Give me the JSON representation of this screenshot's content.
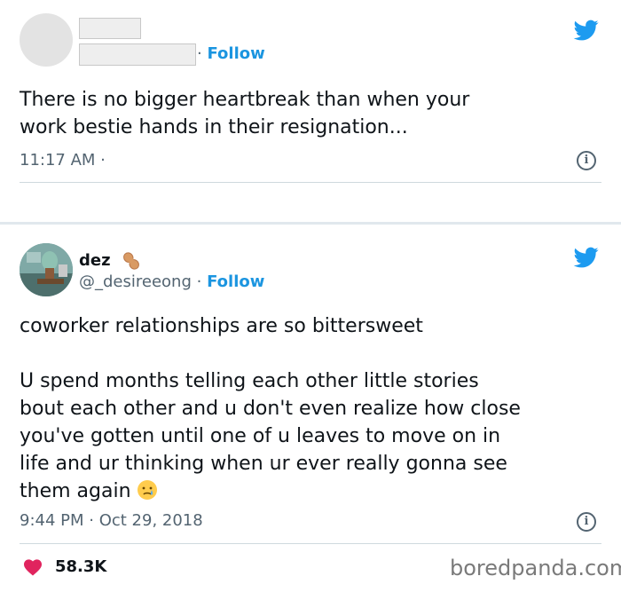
{
  "tweet1": {
    "follow_separator": "·",
    "follow_label": "Follow",
    "text": "There is no bigger heartbreak than when your\nwork bestie hands in their resignation...",
    "time": "11:17 AM ·",
    "info_glyph": "i"
  },
  "tweet2": {
    "display_name": "dez",
    "name_emoji": "peanut-icon",
    "handle": "@_desireeong",
    "follow_separator": "·",
    "follow_label": "Follow",
    "text_line1": "coworker relationships are so bittersweet",
    "text_body": "U spend months telling each other little stories\nbout each other and u don't even realize how close\nyou've gotten until one of u leaves to move on in\nlife and ur thinking when ur ever really gonna see\nthem again",
    "text_emoji": "crying-face-icon",
    "time": "9:44 PM · Oct 29, 2018",
    "info_glyph": "i",
    "likes": "58.3K"
  },
  "watermark": "boredpanda.com",
  "colors": {
    "follow_blue": "#1b95e0",
    "twitter_blue": "#1d9bf0",
    "heart_red": "#e0245e",
    "muted_text": "#536471"
  }
}
